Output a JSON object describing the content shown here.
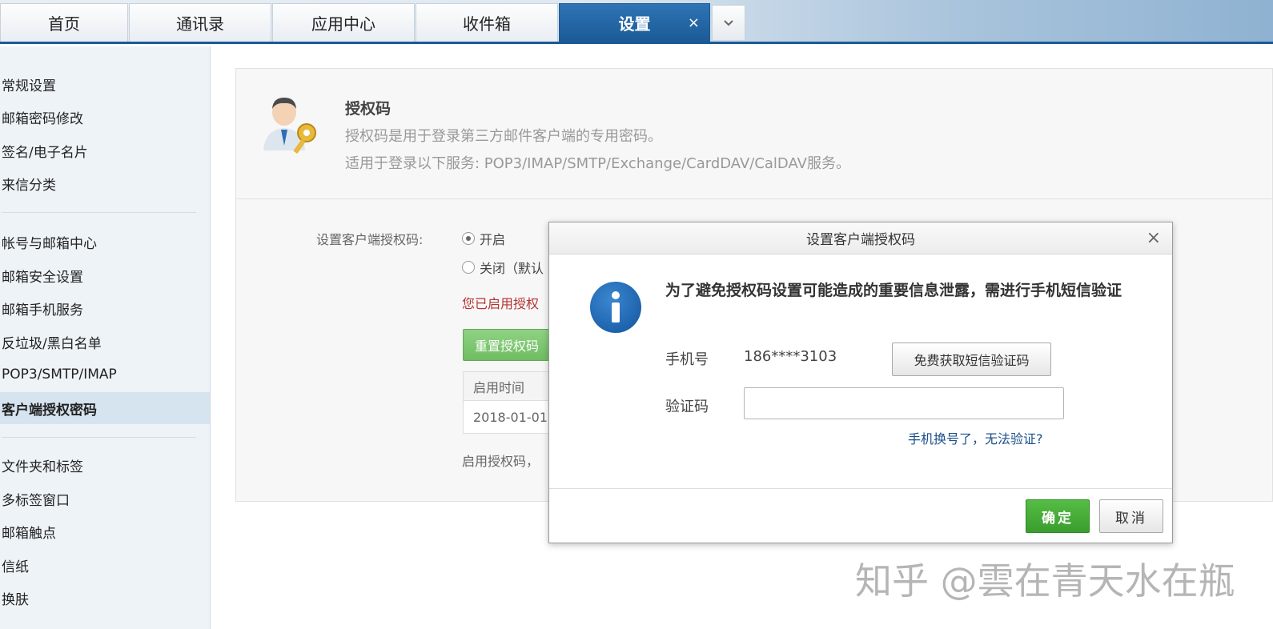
{
  "tabs": [
    {
      "label": "首页"
    },
    {
      "label": "通讯录"
    },
    {
      "label": "应用中心"
    },
    {
      "label": "收件箱"
    },
    {
      "label": "设置",
      "active": true
    }
  ],
  "tab_close_glyph": "×",
  "tab_more_glyph": "⌄",
  "sidebar": {
    "items": [
      "常规设置",
      "邮箱密码修改",
      "签名/电子名片",
      "来信分类",
      "帐号与邮箱中心",
      "邮箱安全设置",
      "邮箱手机服务",
      "反垃圾/黑白名单",
      "POP3/SMTP/IMAP",
      "客户端授权密码",
      "文件夹和标签",
      "多标签窗口",
      "邮箱触点",
      "信纸",
      "换肤"
    ],
    "active_item": "客户端授权密码"
  },
  "panel": {
    "title": "授权码",
    "desc1": "授权码是用于登录第三方邮件客户端的专用密码。",
    "desc2": "适用于登录以下服务: POP3/IMAP/SMTP/Exchange/CardDAV/CalDAV服务。",
    "form_label": "设置客户端授权码:",
    "radio_on": "开启",
    "radio_off": "关闭（默认",
    "notice": "您已启用授权",
    "reset_button": "重置授权码",
    "table_header": "启用时间",
    "table_value": "2018-01-01",
    "foot_note": "启用授权码，"
  },
  "modal": {
    "title": "设置客户端授权码",
    "close_glyph": "×",
    "message": "为了避免授权码设置可能造成的重要信息泄露，需进行手机短信验证",
    "phone_label": "手机号",
    "phone_value": "186****3103",
    "sms_button": "免费获取短信验证码",
    "code_label": "验证码",
    "code_value": "",
    "link_changed": "手机换号了，无法验证?",
    "ok_button": "确定",
    "cancel_button": "取消"
  },
  "watermark": "知乎 @雲在青天水在瓶",
  "colors": {
    "active_tab": "#1b5a96",
    "ok_button": "#3a9c2d",
    "notice_red": "#b53333",
    "link": "#1a4f8a",
    "info_icon": "#1a5fa8"
  }
}
